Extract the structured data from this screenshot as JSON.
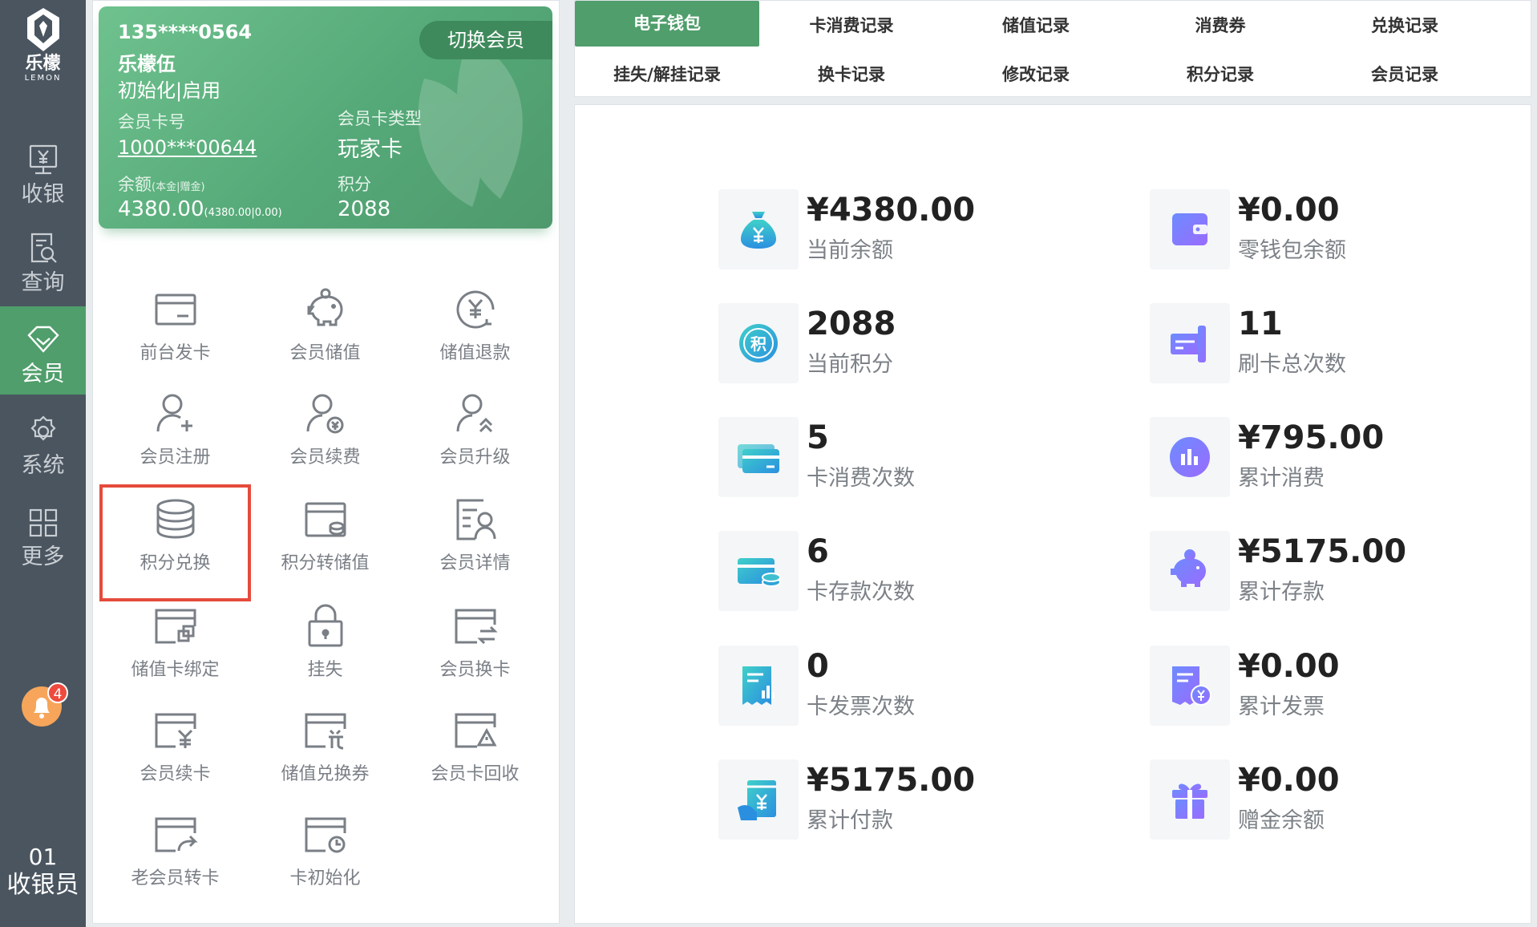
{
  "brand": {
    "name": "乐檬",
    "sub": "LEMON"
  },
  "nav": {
    "items": [
      {
        "label": "收银",
        "icon": "cashier-icon"
      },
      {
        "label": "查询",
        "icon": "query-icon"
      },
      {
        "label": "会员",
        "icon": "diamond-icon"
      },
      {
        "label": "系统",
        "icon": "gear-icon"
      },
      {
        "label": "更多",
        "icon": "grid-icon"
      }
    ],
    "notification_count": "4",
    "user_number": "01",
    "user_role": "收银员"
  },
  "member_card": {
    "phone": "135****0564",
    "name": "乐檬伍",
    "status": "初始化|启用",
    "switch_label": "切换会员",
    "card_no_label": "会员卡号",
    "card_no": "1000***00644",
    "card_type_label": "会员卡类型",
    "card_type": "玩家卡",
    "balance_label": "余额",
    "balance_note": "(本金|赠金)",
    "balance": "4380.00",
    "balance_detail": "(4380.00|0.00)",
    "points_label": "积分",
    "points": "2088"
  },
  "functions": [
    {
      "label": "前台发卡",
      "icon": "card-icon"
    },
    {
      "label": "会员储值",
      "icon": "piggy-bank-icon"
    },
    {
      "label": "储值退款",
      "icon": "refund-icon"
    },
    {
      "label": "会员注册",
      "icon": "user-add-icon"
    },
    {
      "label": "会员续费",
      "icon": "user-renew-icon"
    },
    {
      "label": "会员升级",
      "icon": "user-upgrade-icon"
    },
    {
      "label": "积分兑换",
      "icon": "coin-stack-icon"
    },
    {
      "label": "积分转储值",
      "icon": "wallet-transfer-icon"
    },
    {
      "label": "会员详情",
      "icon": "member-detail-icon"
    },
    {
      "label": "储值卡绑定",
      "icon": "card-bind-icon"
    },
    {
      "label": "挂失",
      "icon": "lock-icon"
    },
    {
      "label": "会员换卡",
      "icon": "card-swap-icon"
    },
    {
      "label": "会员续卡",
      "icon": "card-renew-icon"
    },
    {
      "label": "储值兑换券",
      "icon": "coupon-exchange-icon"
    },
    {
      "label": "会员卡回收",
      "icon": "card-recycle-icon"
    },
    {
      "label": "老会员转卡",
      "icon": "card-transfer-icon"
    },
    {
      "label": "卡初始化",
      "icon": "card-reset-icon"
    }
  ],
  "tabs": [
    {
      "label": "电子钱包",
      "active": true
    },
    {
      "label": "卡消费记录"
    },
    {
      "label": "储值记录"
    },
    {
      "label": "消费券"
    },
    {
      "label": "兑换记录"
    },
    {
      "label": "挂失/解挂记录"
    },
    {
      "label": "换卡记录"
    },
    {
      "label": "修改记录"
    },
    {
      "label": "积分记录"
    },
    {
      "label": "会员记录"
    }
  ],
  "stats": [
    {
      "value": "¥4380.00",
      "label": "当前余额",
      "icon": "money-bag-icon"
    },
    {
      "value": "¥0.00",
      "label": "零钱包余额",
      "icon": "wallet-icon"
    },
    {
      "value": "2088",
      "label": "当前积分",
      "icon": "points-icon"
    },
    {
      "value": "11",
      "label": "刷卡总次数",
      "icon": "swipe-card-icon"
    },
    {
      "value": "5",
      "label": "卡消费次数",
      "icon": "credit-card-icon"
    },
    {
      "value": "¥795.00",
      "label": "累计消费",
      "icon": "bar-chart-icon"
    },
    {
      "value": "6",
      "label": "卡存款次数",
      "icon": "card-deposit-icon"
    },
    {
      "value": "¥5175.00",
      "label": "累计存款",
      "icon": "piggy-icon"
    },
    {
      "value": "0",
      "label": "卡发票次数",
      "icon": "invoice-icon"
    },
    {
      "value": "¥0.00",
      "label": "累计发票",
      "icon": "invoice-yen-icon"
    },
    {
      "value": "¥5175.00",
      "label": "累计付款",
      "icon": "payment-icon"
    },
    {
      "value": "¥0.00",
      "label": "赠金余额",
      "icon": "gift-icon"
    }
  ]
}
